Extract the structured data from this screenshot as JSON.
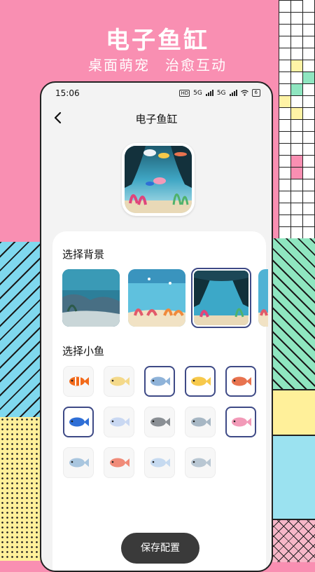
{
  "hero": {
    "title": "电子鱼缸",
    "subtitles": [
      "桌面萌宠",
      "治愈互动"
    ]
  },
  "status_bar": {
    "time": "15:06",
    "hd": "HD",
    "net1": "5G",
    "net2": "5G",
    "battery": "6"
  },
  "nav": {
    "title": "电子鱼缸",
    "back_icon": "chevron-left-icon"
  },
  "sections": {
    "background_title": "选择背景",
    "fish_title": "选择小鱼"
  },
  "backgrounds": [
    {
      "name": "rocky-reef",
      "selected": false
    },
    {
      "name": "coral-garden",
      "selected": false
    },
    {
      "name": "sea-cave",
      "selected": true
    },
    {
      "name": "partial-reef",
      "selected": false
    }
  ],
  "fish": [
    {
      "name": "clownfish",
      "color": "#f26a1b",
      "selected": false
    },
    {
      "name": "butterflyfish",
      "color": "#f4d98a",
      "selected": false
    },
    {
      "name": "blue-tang-striped",
      "color": "#8fb3d9",
      "selected": true
    },
    {
      "name": "yellow-fish",
      "color": "#f7c94c",
      "selected": true
    },
    {
      "name": "red-long-fish",
      "color": "#e8734f",
      "selected": true
    },
    {
      "name": "blue-fish",
      "color": "#2f6fd6",
      "selected": true
    },
    {
      "name": "angelfish",
      "color": "#c9d8f2",
      "selected": false
    },
    {
      "name": "grey-fish",
      "color": "#8a8f94",
      "selected": false
    },
    {
      "name": "silver-fish",
      "color": "#a7b7c4",
      "selected": false
    },
    {
      "name": "pink-fish",
      "color": "#f29ab8",
      "selected": true
    },
    {
      "name": "pale-blue-fish",
      "color": "#a9c6df",
      "selected": false
    },
    {
      "name": "salmon-fish",
      "color": "#f08b79",
      "selected": false
    },
    {
      "name": "dotted-fish",
      "color": "#c6daf0",
      "selected": false
    },
    {
      "name": "striped-angelfish",
      "color": "#b9c7d3",
      "selected": false
    }
  ],
  "save_button": {
    "label": "保存配置"
  },
  "colors": {
    "brand_pink": "#f98fb2",
    "accent_border": "#3e4a86",
    "button_dark": "#3a3a3a"
  }
}
